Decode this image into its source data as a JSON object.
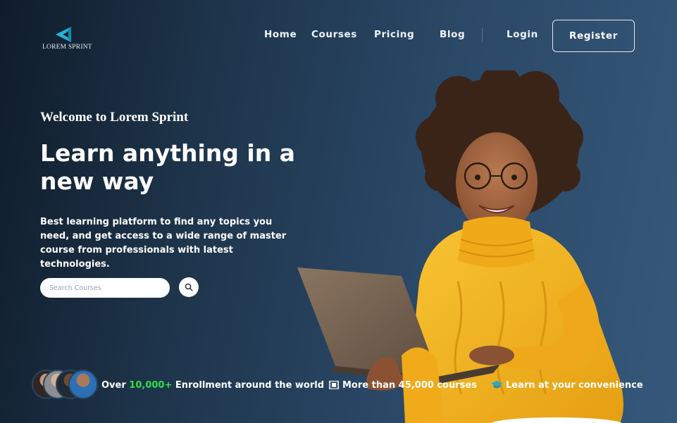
{
  "brand": {
    "name": "LOREM SPRINT",
    "accent": "#1fb6d6"
  },
  "nav": {
    "items": [
      {
        "label": "Home"
      },
      {
        "label": "Courses"
      },
      {
        "label": "Pricing"
      },
      {
        "label": "Blog"
      }
    ],
    "login_label": "Login",
    "register_label": "Register"
  },
  "hero": {
    "welcome": "Welcome to Lorem Sprint",
    "headline": "Learn anything in a new way",
    "description": "Best learning platform to find any topics you need, and get access to a wide range of master course from professionals with latest technologies.",
    "search": {
      "placeholder": "Search Courses",
      "icon": "search-icon"
    }
  },
  "stats": {
    "enrollment": {
      "prefix": "Over",
      "count": "10,000+",
      "suffix": "Enrollment around the world",
      "highlight_color": "#2fe04a"
    },
    "courses": {
      "icon": "film-icon",
      "label": "More than 45,000 courses"
    },
    "convenience": {
      "icon": "graduation-cap-icon",
      "label": "Learn at your convenience"
    }
  },
  "colors": {
    "background_start": "#0f1c2b",
    "background_end": "#35587a",
    "sweater": "#f3b21c"
  }
}
